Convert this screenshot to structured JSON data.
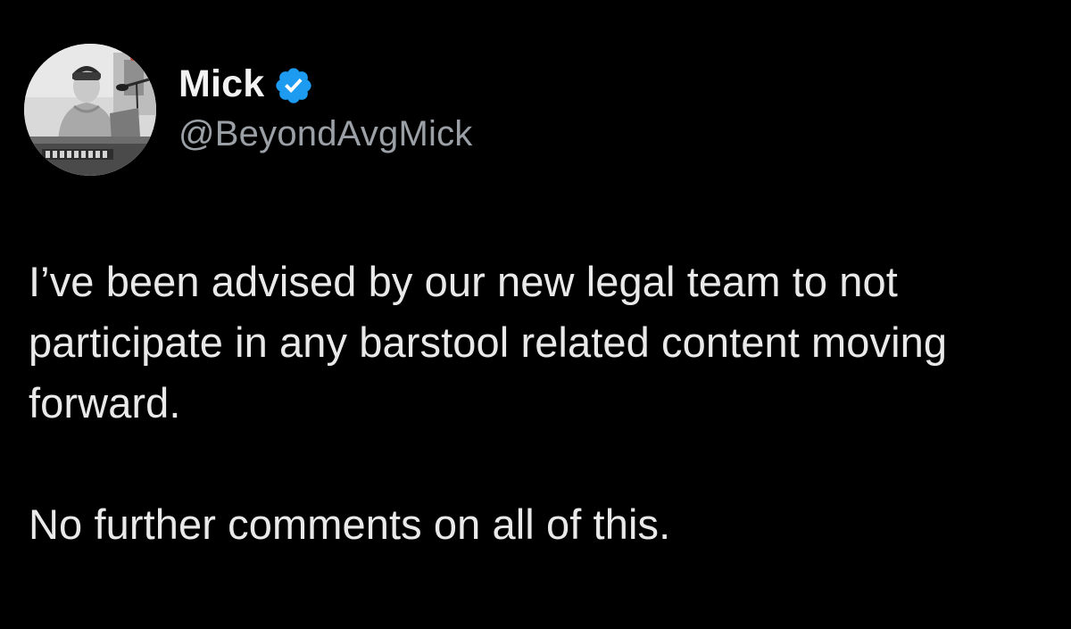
{
  "tweet": {
    "author": {
      "display_name": "Mick",
      "handle": "@BeyondAvgMick",
      "verified": true,
      "verified_icon": "verified-badge-icon",
      "avatar": "profile-photo"
    },
    "paragraphs": [
      "I’ve been advised by our new legal team to not participate in any barstool related content moving forward.",
      "No further comments on all of this."
    ]
  },
  "colors": {
    "background": "#000000",
    "name_text": "#f2f2f2",
    "handle_text": "#9aa0a5",
    "body_text": "#e9e9e9",
    "verified_blue": "#1d9bf0"
  }
}
